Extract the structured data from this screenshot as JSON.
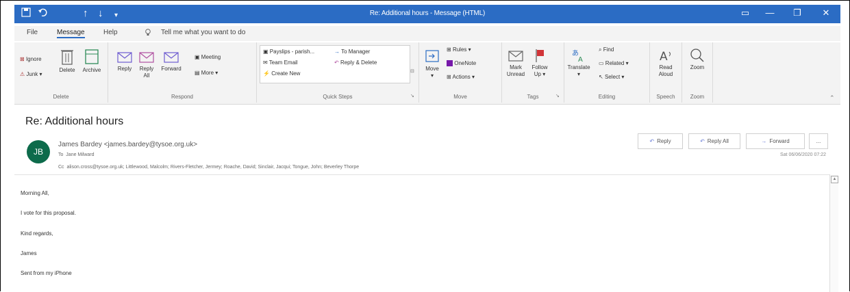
{
  "window": {
    "title": "Re: Additional hours - Message (HTML)",
    "quick_access": {
      "save_icon": "save-icon",
      "undo_icon": "undo-icon",
      "up_icon": "arrow-up-icon",
      "down_icon": "arrow-down-icon",
      "more_icon": "more-icon"
    },
    "controls": {
      "ribbon_display": "▭",
      "minimize": "—",
      "maximize": "❐",
      "close": "✕"
    }
  },
  "menu": {
    "items": [
      "File",
      "Message",
      "Help"
    ],
    "active": "Message",
    "tell_me": "Tell me what you want to do"
  },
  "ribbon": {
    "delete": {
      "label": "Delete",
      "ignore": "Ignore",
      "junk": "Junk",
      "delete": "Delete",
      "archive": "Archive"
    },
    "respond": {
      "label": "Respond",
      "reply": "Reply",
      "reply_all_l1": "Reply",
      "reply_all_l2": "All",
      "forward": "Forward",
      "meeting": "Meeting",
      "more": "More"
    },
    "quick_steps": {
      "label": "Quick Steps",
      "items": [
        "Payslips - parish...",
        "To Manager",
        "Team Email",
        "Reply & Delete",
        "Create New"
      ]
    },
    "move": {
      "label": "Move",
      "move": "Move",
      "rules": "Rules",
      "onenote": "OneNote",
      "actions": "Actions"
    },
    "tags": {
      "label": "Tags",
      "mark_unread_l1": "Mark",
      "mark_unread_l2": "Unread",
      "follow_up_l1": "Follow",
      "follow_up_l2": "Up"
    },
    "editing": {
      "label": "Editing",
      "translate": "Translate",
      "find": "Find",
      "related": "Related",
      "select": "Select"
    },
    "speech": {
      "label": "Speech",
      "read_aloud_l1": "Read",
      "read_aloud_l2": "Aloud"
    },
    "zoom": {
      "label": "Zoom",
      "zoom": "Zoom"
    }
  },
  "message": {
    "subject": "Re: Additional hours",
    "avatar_initials": "JB",
    "from": "James Bardey <james.bardey@tysoe.org.uk>",
    "to_label": "To",
    "to": "Jane Milward",
    "cc_label": "Cc",
    "cc": "alison.cross@tysoe.org.uk; Littlewood, Malcolm; Rivers-Fletcher, Jermey; Roache, David; Sinclair, Jacqui; Tongue, John; Beverley Thorpe",
    "date": "Sat 06/06/2020 07:22",
    "actions": {
      "reply": "Reply",
      "reply_all": "Reply All",
      "forward": "Forward",
      "more": "..."
    },
    "body": [
      "Morning All,",
      "I vote for this proposal.",
      "Kind regards,",
      "James",
      "Sent from my iPhone"
    ]
  },
  "colors": {
    "accent": "#2b6cc4",
    "avatar": "#0d6b4b",
    "flag": "#d13438"
  }
}
